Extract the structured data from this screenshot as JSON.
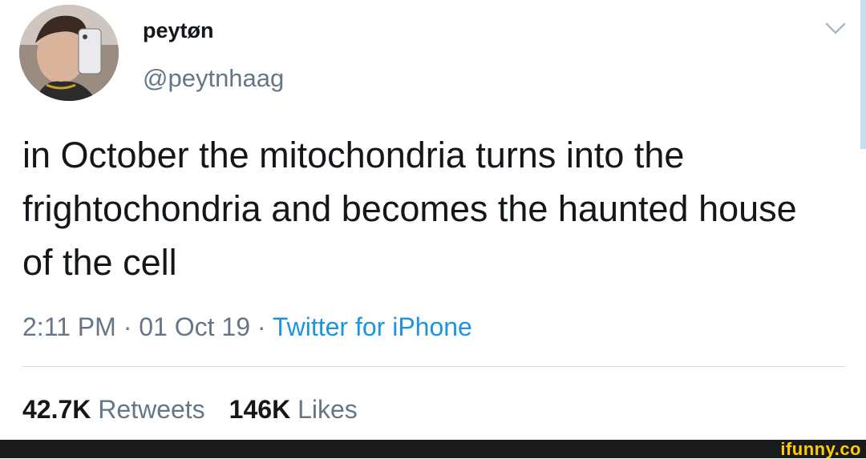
{
  "author": {
    "display_name": "peytøn",
    "handle": "@peytnhaag",
    "avatar_icon": "user-avatar-photo"
  },
  "tweet": {
    "text": "in October the mitochondria turns into the frightochondria and becomes the haunted house of the cell",
    "time": "2:11 PM",
    "date": "01 Oct 19",
    "separator": "·",
    "source": "Twitter for iPhone"
  },
  "stats": {
    "retweets_count": "42.7K",
    "retweets_label": "Retweets",
    "likes_count": "146K",
    "likes_label": "Likes"
  },
  "menu_icon": "chevron-down-icon",
  "watermark": "ifunny.co",
  "colors": {
    "text_primary": "#14171a",
    "text_secondary": "#657786",
    "link": "#1b95e0",
    "watermark": "#ffcc00",
    "scroll_indicator": "#c3def0"
  }
}
